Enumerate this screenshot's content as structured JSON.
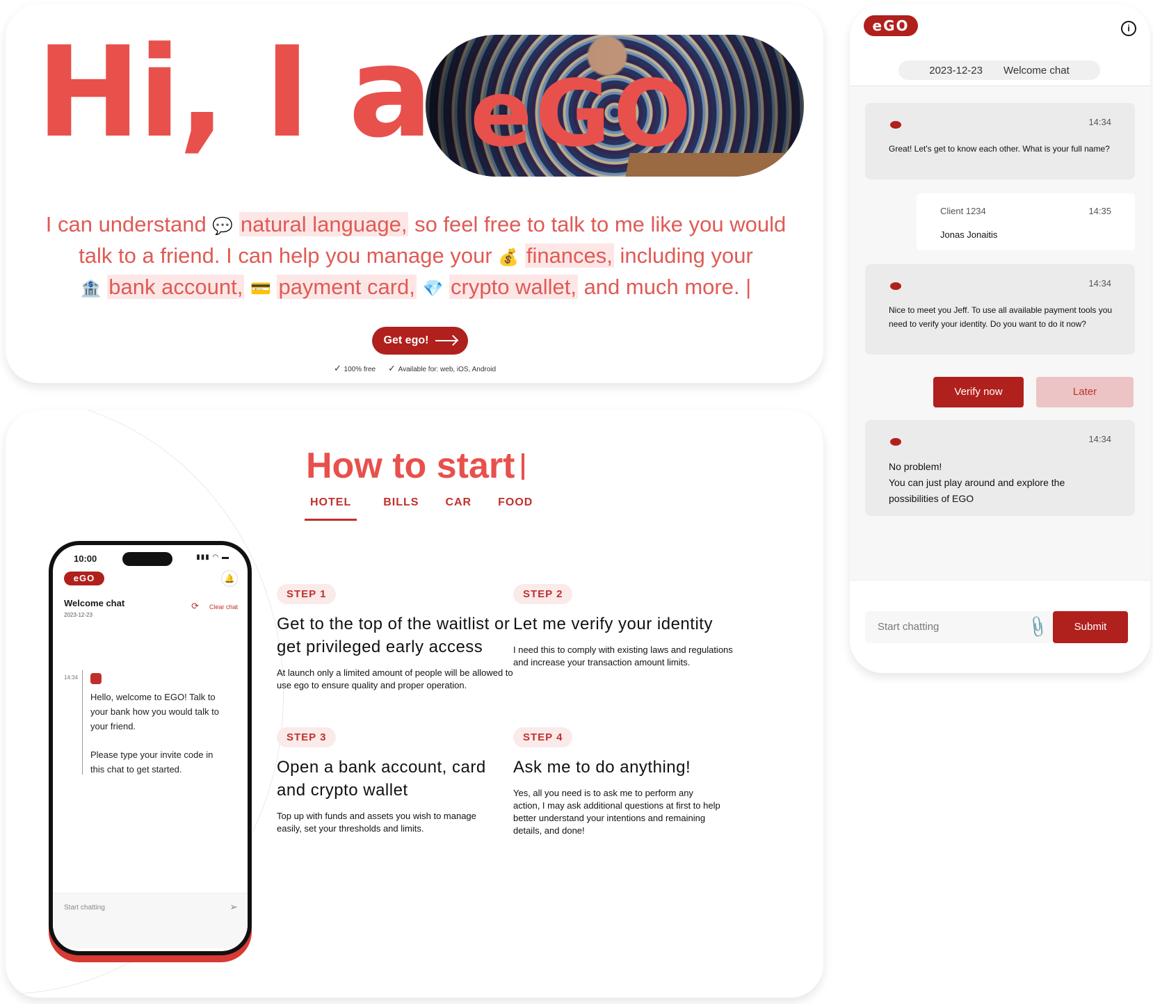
{
  "hero": {
    "title": "Hi, I am",
    "logo_text": "eGO",
    "text_1": "I can understand",
    "highlight_1": "natural language,",
    "text_2": "so feel free  to talk to me like you would talk to a friend. I can help you manage your",
    "highlight_2": "finances,",
    "text_3": "including your",
    "highlight_3": "bank account,",
    "highlight_4": "payment card,",
    "highlight_5": "crypto wallet,",
    "text_4": " and much more.   |",
    "icons": [
      "speech-bubble-icon",
      "money-bag-icon",
      "bank-icon",
      "credit-card-icon",
      "gem-icon"
    ],
    "cta_label": "Get ego!",
    "check_1": "100% free",
    "check_2": "Available for: web, iOS, Android"
  },
  "howto": {
    "title": "How to start",
    "tabs": [
      "HOTEL",
      "BILLS",
      "CAR",
      "FOOD"
    ],
    "active_tab": "HOTEL",
    "steps": [
      {
        "badge": "STEP 1",
        "title": "Get to the top of the waitlist or get privileged early access",
        "desc": "At launch only a limited amount of people will be allowed to use ego to ensure quality and proper operation."
      },
      {
        "badge": "STEP 2",
        "title": "Let me verify your identity",
        "desc": "I need this to comply with existing laws and regulations and increase your transaction amount limits."
      },
      {
        "badge": "STEP 3",
        "title": "Open a bank account, card and crypto wallet",
        "desc": "Top up with funds and assets you wish to manage easily, set your thresholds and limits."
      },
      {
        "badge": "STEP 4",
        "title": "Ask me to do anything!",
        "desc": "Yes, all you need is to ask me to perform any action, I may ask additional questions at first to help better understand your intentions and remaining details, and done!"
      }
    ]
  },
  "phone": {
    "time": "10:00",
    "logo": "eGO",
    "chat_title": "Welcome chat",
    "date": "2023-12-23",
    "clear_chat": "Clear chat",
    "msg_time": "14:34",
    "msg_1": "Hello, welcome to EGO! Talk to your bank how you would talk to your friend.",
    "msg_2": "Please type your invite code in this chat to get started.",
    "input_placeholder": "Start chatting"
  },
  "chat": {
    "logo": "eGO",
    "date": "2023-12-23",
    "title": "Welcome chat",
    "messages": [
      {
        "time": "14:34",
        "text": "Great! Let's get to know each other. What is your full name?"
      },
      {
        "sender": "Client 1234",
        "time": "14:35",
        "text": "Jonas Jonaitis"
      },
      {
        "time": "14:34",
        "text": "Nice to meet you Jeff. To use all available payment tools you need to verify your identity. Do you want to do it now?"
      },
      {
        "time": "14:34",
        "text_1": "No problem!",
        "text_2": "You can just play around and explore the possibilities of EGO"
      }
    ],
    "verify_label": "Verify now",
    "later_label": "Later",
    "input_placeholder": "Start chatting",
    "submit_label": "Submit"
  },
  "colors": {
    "brand": "#b0201c",
    "accent": "#e8504c",
    "highlight": "#fde7e6"
  }
}
